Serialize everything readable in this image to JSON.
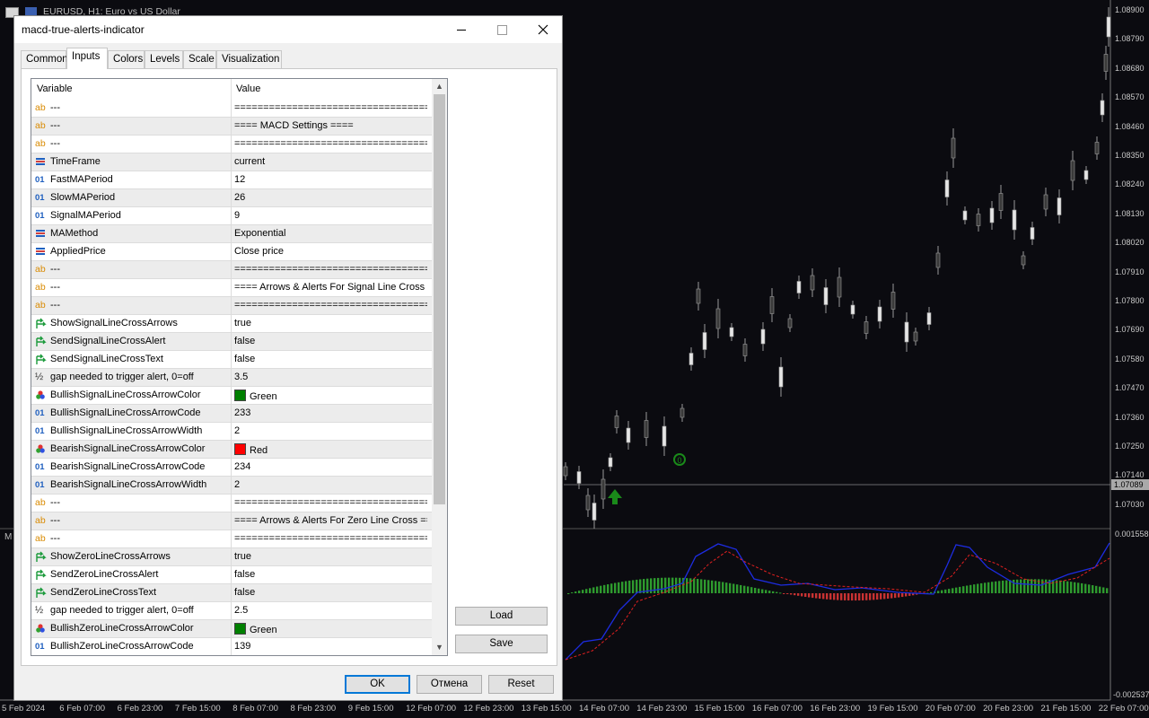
{
  "chart": {
    "title": "EURUSD, H1:  Euro vs US Dollar",
    "price_scale": [
      "1.08900",
      "1.08790",
      "1.08680",
      "1.08570",
      "1.08460",
      "1.08350",
      "1.08240",
      "1.08130",
      "1.08020",
      "1.07910",
      "1.07800",
      "1.07690",
      "1.07580",
      "1.07470",
      "1.07360",
      "1.07250",
      "1.07140",
      "1.07030"
    ],
    "current_price": "1.07089",
    "indicator_max": "0.001558",
    "indicator_min": "-0.002537",
    "time_labels": [
      "5 Feb 2024",
      "6 Feb 07:00",
      "6 Feb 23:00",
      "7 Feb 15:00",
      "8 Feb 07:00",
      "8 Feb 23:00",
      "9 Feb 15:00",
      "12 Feb 07:00",
      "12 Feb 23:00",
      "13 Feb 15:00",
      "14 Feb 07:00",
      "14 Feb 23:00",
      "15 Feb 15:00",
      "16 Feb 07:00",
      "16 Feb 23:00",
      "19 Feb 15:00",
      "20 Feb 07:00",
      "20 Feb 23:00",
      "21 Feb 15:00",
      "22 Feb 07:00"
    ],
    "indicator_label": "M",
    "zero_marker": "0",
    "colors": {
      "bull_arrow": "#1a8a1a",
      "macd_line": "#1d2ce0",
      "signal_line": "#e02020",
      "hist_pos": "#2e9a2e",
      "hist_neg": "#c83232"
    }
  },
  "dialog": {
    "title": "macd-true-alerts-indicator",
    "tabs": [
      "Common",
      "Inputs",
      "Colors",
      "Levels",
      "Scale",
      "Visualization"
    ],
    "active_tab": "Inputs",
    "columns": {
      "variable": "Variable",
      "value": "Value"
    },
    "rows": [
      {
        "icon": "ab",
        "name": "---",
        "value": "==========================================="
      },
      {
        "icon": "ab",
        "name": "---",
        "value": "==== MACD Settings ===="
      },
      {
        "icon": "ab",
        "name": "---",
        "value": "==========================================="
      },
      {
        "icon": "enum",
        "name": "TimeFrame",
        "value": "current"
      },
      {
        "icon": "01",
        "name": "FastMAPeriod",
        "value": "12"
      },
      {
        "icon": "01",
        "name": "SlowMAPeriod",
        "value": "26"
      },
      {
        "icon": "01",
        "name": "SignalMAPeriod",
        "value": "9"
      },
      {
        "icon": "enum",
        "name": "MAMethod",
        "value": "Exponential"
      },
      {
        "icon": "enum",
        "name": "AppliedPrice",
        "value": "Close price"
      },
      {
        "icon": "ab",
        "name": "---",
        "value": "==========================================="
      },
      {
        "icon": "ab",
        "name": "---",
        "value": "==== Arrows & Alerts For Signal Line Cross ===="
      },
      {
        "icon": "ab",
        "name": "---",
        "value": "==========================================="
      },
      {
        "icon": "bool",
        "name": "ShowSignalLineCrossArrows",
        "value": "true"
      },
      {
        "icon": "bool",
        "name": "SendSignalLineCrossAlert",
        "value": "false"
      },
      {
        "icon": "bool",
        "name": "SendSignalLineCrossText",
        "value": "false"
      },
      {
        "icon": "half",
        "name": "gap needed to trigger alert, 0=off",
        "value": "3.5"
      },
      {
        "icon": "color",
        "name": "BullishSignalLineCrossArrowColor",
        "value": "Green",
        "swatch": "#008000"
      },
      {
        "icon": "01",
        "name": "BullishSignalLineCrossArrowCode",
        "value": "233"
      },
      {
        "icon": "01",
        "name": "BullishSignalLineCrossArrowWidth",
        "value": "2"
      },
      {
        "icon": "color",
        "name": "BearishSignalLineCrossArrowColor",
        "value": "Red",
        "swatch": "#ff0000"
      },
      {
        "icon": "01",
        "name": "BearishSignalLineCrossArrowCode",
        "value": "234"
      },
      {
        "icon": "01",
        "name": "BearishSignalLineCrossArrowWidth",
        "value": "2"
      },
      {
        "icon": "ab",
        "name": "---",
        "value": "==========================================="
      },
      {
        "icon": "ab",
        "name": "---",
        "value": "==== Arrows & Alerts For Zero Line Cross ===="
      },
      {
        "icon": "ab",
        "name": "---",
        "value": "==========================================="
      },
      {
        "icon": "bool",
        "name": "ShowZeroLineCrossArrows",
        "value": "true"
      },
      {
        "icon": "bool",
        "name": "SendZeroLineCrossAlert",
        "value": "false"
      },
      {
        "icon": "bool",
        "name": "SendZeroLineCrossText",
        "value": "false"
      },
      {
        "icon": "half",
        "name": "gap needed to trigger alert, 0=off",
        "value": "2.5"
      },
      {
        "icon": "color",
        "name": "BullishZeroLineCrossArrowColor",
        "value": "Green",
        "swatch": "#008000"
      },
      {
        "icon": "01",
        "name": "BullishZeroLineCrossArrowCode",
        "value": "139"
      }
    ],
    "buttons": {
      "load": "Load",
      "save": "Save",
      "ok": "OK",
      "cancel": "Отмена",
      "reset": "Reset"
    }
  }
}
